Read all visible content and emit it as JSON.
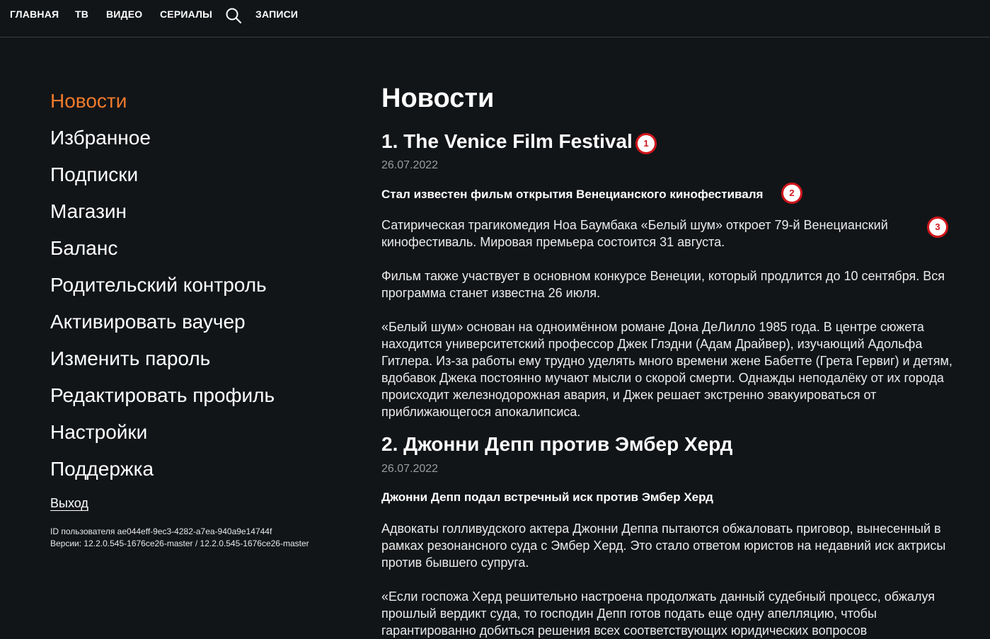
{
  "nav": {
    "items": [
      "ГЛАВНАЯ",
      "ТВ",
      "ВИДЕО",
      "СЕРИАЛЫ",
      "ЗАПИСИ"
    ],
    "search_icon": "search-icon"
  },
  "sidebar": {
    "items": [
      "Новости",
      "Избранное",
      "Подписки",
      "Магазин",
      "Баланс",
      "Родительский контроль",
      "Активировать ваучер",
      "Изменить пароль",
      "Редактировать профиль",
      "Настройки",
      "Поддержка"
    ],
    "active_index": 0,
    "logout": "Выход",
    "user_id": "ID пользователя ae044eff-9ec3-4282-a7ea-940a9e14744f",
    "versions": "Версии: 12.2.0.545-1676ce26-master / 12.2.0.545-1676ce26-master"
  },
  "main": {
    "title": "Новости",
    "articles": [
      {
        "title": "1. The Venice Film Festival",
        "date": "26.07.2022",
        "subtitle": "Стал известен фильм открытия Венецианского кинофестиваля",
        "paragraphs": [
          "Сатирическая трагикомедия Ноа Баумбака «Белый шум» откроет 79-й Венецианский кинофестиваль. Мировая премьера состоится 31 августа.",
          "Фильм также участвует в основном конкурсе Венеции, который продлится до 10 сентября. Вся программа станет известна 26 июля.",
          "«Белый шум» основан на одноимённом романе Дона ДеЛилло 1985 года. В центре сюжета находится университетский профессор Джек Глэдни (Адам Драйвер), изучающий Адольфа Гитлера. Из-за работы ему трудно уделять много времени жене Бабетте (Грета Гервиг) и детям, вдобавок Джека постоянно мучают мысли о скорой смерти. Однажды неподалёку от их города происходит железнодорожная авария, и Джек решает экстренно эвакуироваться от приближающегося апокалипсиса."
        ]
      },
      {
        "title": "2. Джонни Депп против Эмбер Херд",
        "date": "26.07.2022",
        "subtitle": "Джонни Депп подал встречный иск против Эмбер Херд",
        "paragraphs": [
          "Адвокаты голливудского актера Джонни Деппа пытаются обжаловать приговор, вынесенный в рамках резонансного суда с Эмбер Херд. Это стало ответом юристов на недавний иск актрисы против бывшего супруга.",
          "«Если госпожа Херд решительно настроена продолжать данный судебный процесс, обжалуя прошлый вердикт суда, то господин Депп готов подать еще одну апелляцию, чтобы гарантированно добиться решения всех соответствующих юридических вопросов"
        ]
      }
    ]
  },
  "annotations": [
    "1",
    "2",
    "3"
  ],
  "colors": {
    "background": "#121518",
    "accent": "#f07a2c",
    "badge_border": "#d0161b",
    "date": "#9a9da0"
  }
}
